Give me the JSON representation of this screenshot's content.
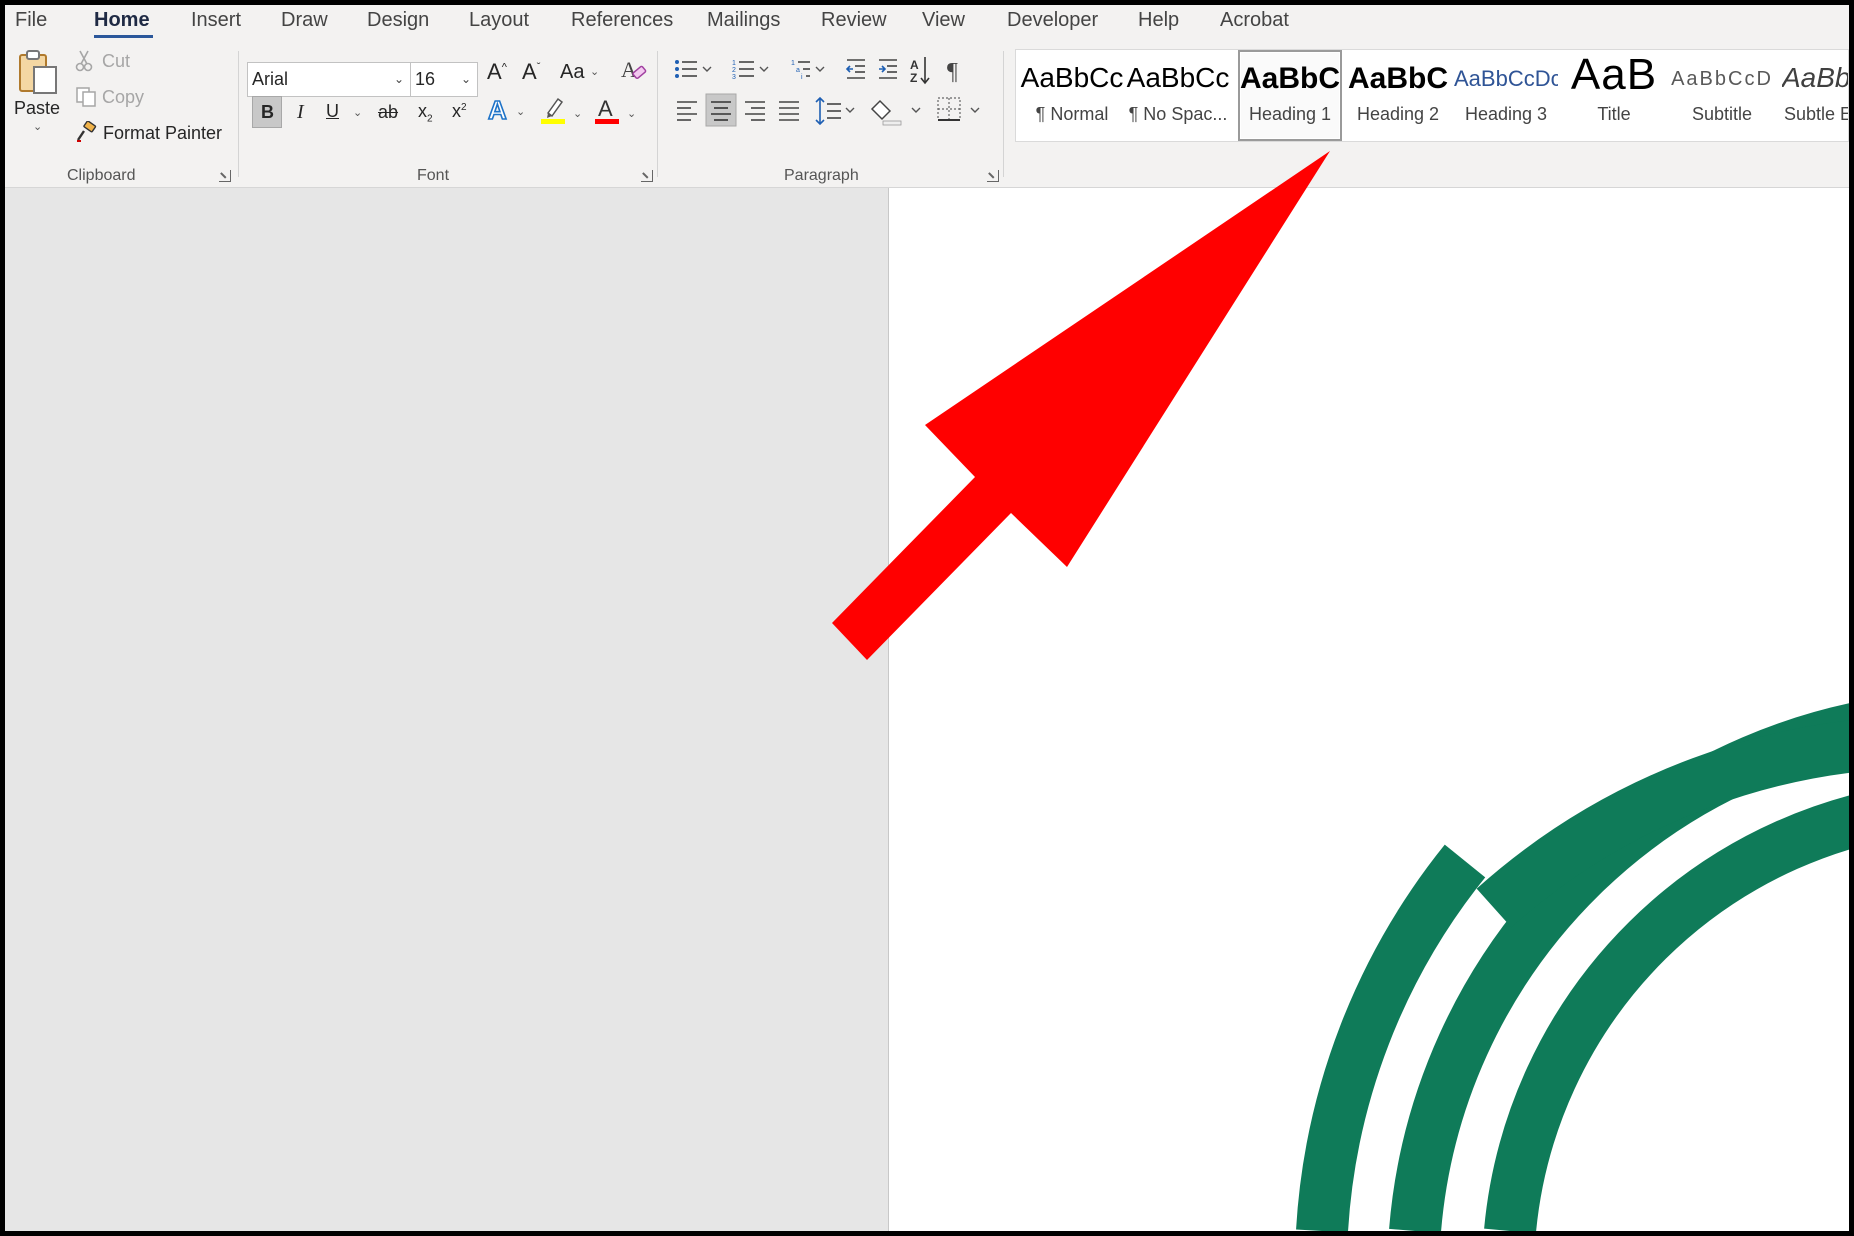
{
  "tabs": [
    "File",
    "Home",
    "Insert",
    "Draw",
    "Design",
    "Layout",
    "References",
    "Mailings",
    "Review",
    "View",
    "Developer",
    "Help",
    "Acrobat"
  ],
  "active_tab": "Home",
  "clipboard": {
    "paste": "Paste",
    "cut": "Cut",
    "copy": "Copy",
    "format_painter": "Format Painter",
    "group_label": "Clipboard"
  },
  "font": {
    "name": "Arial",
    "size": "16",
    "change_case": "Aa",
    "group_label": "Font",
    "bold_active": true,
    "highlight_color": "#ffff00",
    "font_color": "#ff0000"
  },
  "paragraph": {
    "group_label": "Paragraph",
    "align_active": "center"
  },
  "styles": {
    "selected": "Heading 1",
    "items": [
      {
        "preview": "AaBbCc",
        "name": "¶ Normal"
      },
      {
        "preview": "AaBbCc",
        "name": "¶ No Spac..."
      },
      {
        "preview": "AaBbC",
        "name": "Heading 1"
      },
      {
        "preview": "AaBbC",
        "name": "Heading 2"
      },
      {
        "preview": "AaBbCcDc",
        "name": "Heading 3"
      },
      {
        "preview": "AaB",
        "name": "Title"
      },
      {
        "preview": "AaBbCcD",
        "name": "Subtitle"
      },
      {
        "preview": "AaBbC",
        "name": "Subtle Em"
      }
    ]
  },
  "colors": {
    "accent_blue": "#2b579a",
    "arrow_red": "#ff0000",
    "logo_green": "#0f7b59",
    "heading3_blue": "#2f5496",
    "subtitle_gray": "#595959"
  }
}
